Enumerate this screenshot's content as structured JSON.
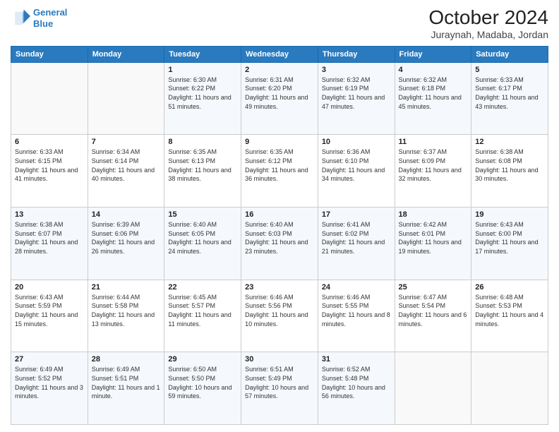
{
  "logo": {
    "line1": "General",
    "line2": "Blue"
  },
  "title": "October 2024",
  "subtitle": "Juraynah, Madaba, Jordan",
  "days_header": [
    "Sunday",
    "Monday",
    "Tuesday",
    "Wednesday",
    "Thursday",
    "Friday",
    "Saturday"
  ],
  "weeks": [
    [
      {
        "day": "",
        "info": ""
      },
      {
        "day": "",
        "info": ""
      },
      {
        "day": "1",
        "info": "Sunrise: 6:30 AM\nSunset: 6:22 PM\nDaylight: 11 hours and 51 minutes."
      },
      {
        "day": "2",
        "info": "Sunrise: 6:31 AM\nSunset: 6:20 PM\nDaylight: 11 hours and 49 minutes."
      },
      {
        "day": "3",
        "info": "Sunrise: 6:32 AM\nSunset: 6:19 PM\nDaylight: 11 hours and 47 minutes."
      },
      {
        "day": "4",
        "info": "Sunrise: 6:32 AM\nSunset: 6:18 PM\nDaylight: 11 hours and 45 minutes."
      },
      {
        "day": "5",
        "info": "Sunrise: 6:33 AM\nSunset: 6:17 PM\nDaylight: 11 hours and 43 minutes."
      }
    ],
    [
      {
        "day": "6",
        "info": "Sunrise: 6:33 AM\nSunset: 6:15 PM\nDaylight: 11 hours and 41 minutes."
      },
      {
        "day": "7",
        "info": "Sunrise: 6:34 AM\nSunset: 6:14 PM\nDaylight: 11 hours and 40 minutes."
      },
      {
        "day": "8",
        "info": "Sunrise: 6:35 AM\nSunset: 6:13 PM\nDaylight: 11 hours and 38 minutes."
      },
      {
        "day": "9",
        "info": "Sunrise: 6:35 AM\nSunset: 6:12 PM\nDaylight: 11 hours and 36 minutes."
      },
      {
        "day": "10",
        "info": "Sunrise: 6:36 AM\nSunset: 6:10 PM\nDaylight: 11 hours and 34 minutes."
      },
      {
        "day": "11",
        "info": "Sunrise: 6:37 AM\nSunset: 6:09 PM\nDaylight: 11 hours and 32 minutes."
      },
      {
        "day": "12",
        "info": "Sunrise: 6:38 AM\nSunset: 6:08 PM\nDaylight: 11 hours and 30 minutes."
      }
    ],
    [
      {
        "day": "13",
        "info": "Sunrise: 6:38 AM\nSunset: 6:07 PM\nDaylight: 11 hours and 28 minutes."
      },
      {
        "day": "14",
        "info": "Sunrise: 6:39 AM\nSunset: 6:06 PM\nDaylight: 11 hours and 26 minutes."
      },
      {
        "day": "15",
        "info": "Sunrise: 6:40 AM\nSunset: 6:05 PM\nDaylight: 11 hours and 24 minutes."
      },
      {
        "day": "16",
        "info": "Sunrise: 6:40 AM\nSunset: 6:03 PM\nDaylight: 11 hours and 23 minutes."
      },
      {
        "day": "17",
        "info": "Sunrise: 6:41 AM\nSunset: 6:02 PM\nDaylight: 11 hours and 21 minutes."
      },
      {
        "day": "18",
        "info": "Sunrise: 6:42 AM\nSunset: 6:01 PM\nDaylight: 11 hours and 19 minutes."
      },
      {
        "day": "19",
        "info": "Sunrise: 6:43 AM\nSunset: 6:00 PM\nDaylight: 11 hours and 17 minutes."
      }
    ],
    [
      {
        "day": "20",
        "info": "Sunrise: 6:43 AM\nSunset: 5:59 PM\nDaylight: 11 hours and 15 minutes."
      },
      {
        "day": "21",
        "info": "Sunrise: 6:44 AM\nSunset: 5:58 PM\nDaylight: 11 hours and 13 minutes."
      },
      {
        "day": "22",
        "info": "Sunrise: 6:45 AM\nSunset: 5:57 PM\nDaylight: 11 hours and 11 minutes."
      },
      {
        "day": "23",
        "info": "Sunrise: 6:46 AM\nSunset: 5:56 PM\nDaylight: 11 hours and 10 minutes."
      },
      {
        "day": "24",
        "info": "Sunrise: 6:46 AM\nSunset: 5:55 PM\nDaylight: 11 hours and 8 minutes."
      },
      {
        "day": "25",
        "info": "Sunrise: 6:47 AM\nSunset: 5:54 PM\nDaylight: 11 hours and 6 minutes."
      },
      {
        "day": "26",
        "info": "Sunrise: 6:48 AM\nSunset: 5:53 PM\nDaylight: 11 hours and 4 minutes."
      }
    ],
    [
      {
        "day": "27",
        "info": "Sunrise: 6:49 AM\nSunset: 5:52 PM\nDaylight: 11 hours and 3 minutes."
      },
      {
        "day": "28",
        "info": "Sunrise: 6:49 AM\nSunset: 5:51 PM\nDaylight: 11 hours and 1 minute."
      },
      {
        "day": "29",
        "info": "Sunrise: 6:50 AM\nSunset: 5:50 PM\nDaylight: 10 hours and 59 minutes."
      },
      {
        "day": "30",
        "info": "Sunrise: 6:51 AM\nSunset: 5:49 PM\nDaylight: 10 hours and 57 minutes."
      },
      {
        "day": "31",
        "info": "Sunrise: 6:52 AM\nSunset: 5:48 PM\nDaylight: 10 hours and 56 minutes."
      },
      {
        "day": "",
        "info": ""
      },
      {
        "day": "",
        "info": ""
      }
    ]
  ]
}
